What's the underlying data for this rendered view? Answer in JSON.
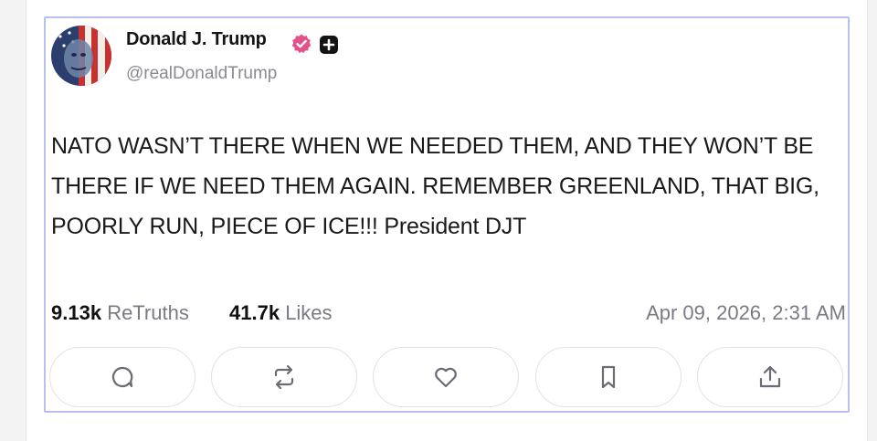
{
  "post": {
    "author": {
      "display_name": "Donald J. Trump",
      "handle": "@realDonaldTrump",
      "verified_icon": "verified-badge-icon",
      "plus_icon": "plus-square-icon"
    },
    "text": "NATO WASN’T THERE WHEN WE NEEDED THEM, AND THEY WON’T BE THERE IF WE NEED THEM AGAIN. REMEMBER GREENLAND, THAT BIG, POORLY RUN, PIECE OF ICE!!! President DJT",
    "stats": {
      "retruths_count": "9.13k",
      "retruths_label": "ReTruths",
      "likes_count": "41.7k",
      "likes_label": "Likes"
    },
    "timestamp": "Apr 09, 2026, 2:31 AM",
    "actions": [
      {
        "icon": "reply-icon"
      },
      {
        "icon": "retruth-icon"
      },
      {
        "icon": "heart-icon"
      },
      {
        "icon": "bookmark-icon"
      },
      {
        "icon": "share-icon"
      }
    ]
  },
  "colors": {
    "verified": "#e4508a",
    "card_border": "#b9c0f0",
    "muted_text": "#7a7a86",
    "icon_gray": "#6b6b75"
  }
}
